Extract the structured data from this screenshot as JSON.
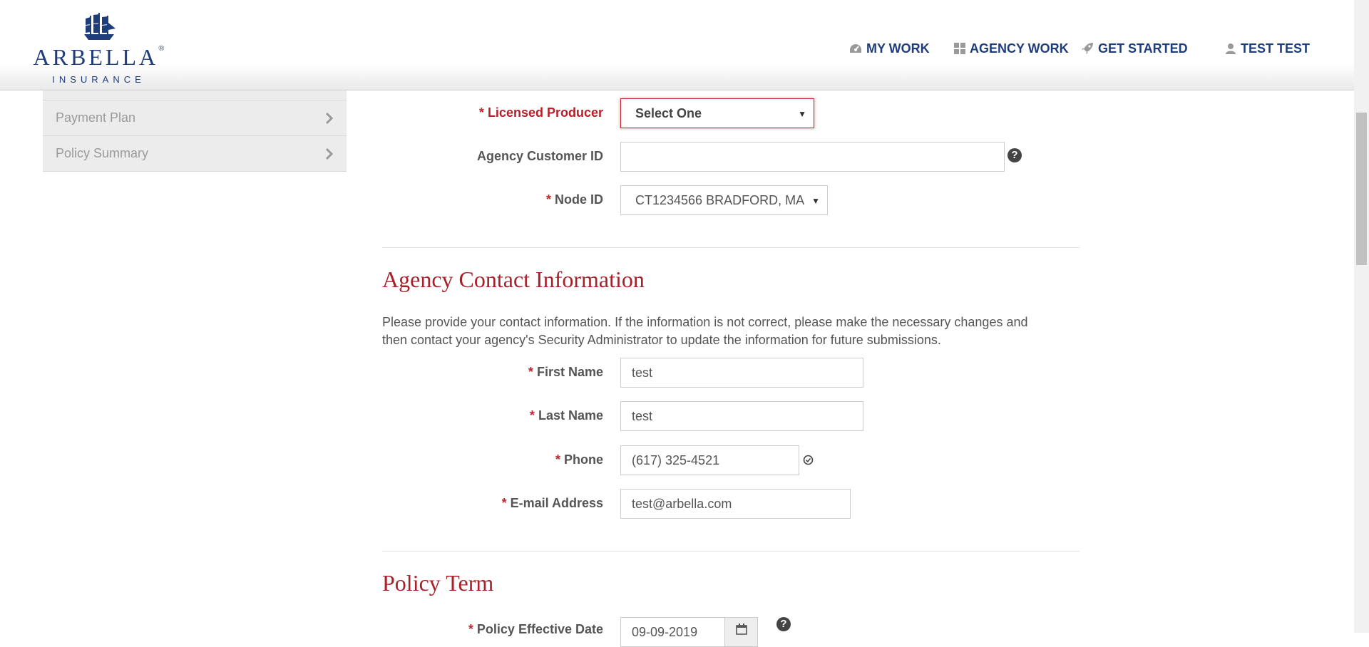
{
  "brand": {
    "name": "ARBELLA",
    "registered": "®",
    "subname": "INSURANCE"
  },
  "nav": {
    "my_work": "MY WORK",
    "agency_work": "AGENCY WORK",
    "get_started": "GET STARTED",
    "user": "TEST TEST"
  },
  "sidebar": {
    "items": [
      {
        "label": "Payment Plan"
      },
      {
        "label": "Policy Summary"
      }
    ]
  },
  "form": {
    "licensed_producer": {
      "required": "*",
      "label": "Licensed Producer",
      "value": "Select One"
    },
    "agency_customer_id": {
      "label": "Agency Customer ID",
      "value": ""
    },
    "node_id": {
      "required": "*",
      "label": "Node ID",
      "value": "CT1234566 BRADFORD, MA"
    }
  },
  "contact": {
    "title": "Agency Contact Information",
    "description": "Please provide your contact information. If the information is not correct, please make the necessary changes and then contact your agency's Security Administrator to update the information for future submissions.",
    "first_name": {
      "required": "*",
      "label": "First Name",
      "value": "test"
    },
    "last_name": {
      "required": "*",
      "label": "Last Name",
      "value": "test"
    },
    "phone": {
      "required": "*",
      "label": "Phone",
      "value": "(617) 325-4521"
    },
    "email": {
      "required": "*",
      "label": "E-mail Address",
      "value": "test@arbella.com"
    }
  },
  "policy_term": {
    "title": "Policy Term",
    "effective_date": {
      "required": "*",
      "label": "Policy Effective Date",
      "value": "09-09-2019"
    }
  },
  "colors": {
    "brand_blue": "#1f3d7a",
    "accent_red": "#a8202a",
    "required_red": "#c0262d"
  },
  "icons": [
    "ship-logo-icon",
    "dashboard-icon",
    "grid-icon",
    "rocket-icon",
    "user-icon",
    "chevron-right-icon",
    "help-icon",
    "verified-check-icon",
    "calendar-icon",
    "dropdown-arrow-icon"
  ]
}
